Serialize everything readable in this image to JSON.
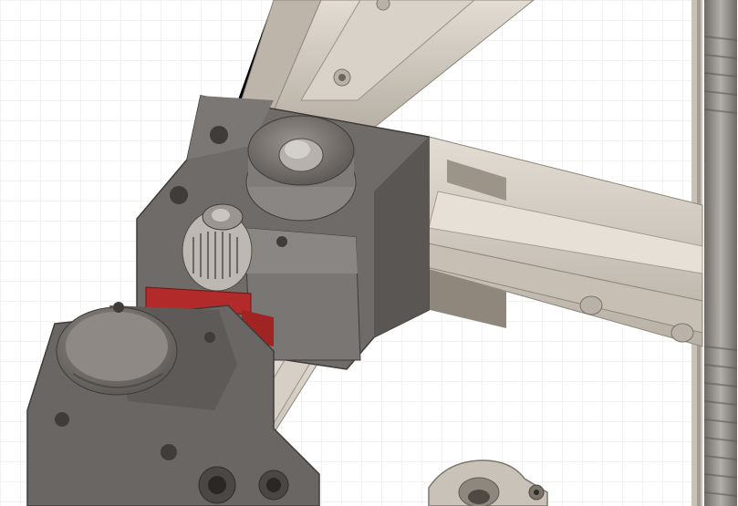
{
  "viewport": {
    "kind": "3d-model-viewport",
    "background": "#ffffff",
    "grid_color": "#dcdcdc",
    "colors": {
      "plastic_body": "#6f6b68",
      "plastic_light": "#8a8683",
      "plastic_dark": "#4f4c4a",
      "aluminum_extrusion": "#cfc8be",
      "aluminum_shadow": "#a9a196",
      "accent_red": "#b22a2a",
      "threaded_rod": "#8c8a86"
    },
    "components": [
      "grid-plane",
      "vertical-extrusion-rail",
      "horizontal-extrusion-rail",
      "threaded-rod",
      "corner-block",
      "idler-pulley",
      "gt2-pulley",
      "belt-clamp",
      "motor-mount",
      "rod-clamp"
    ]
  }
}
